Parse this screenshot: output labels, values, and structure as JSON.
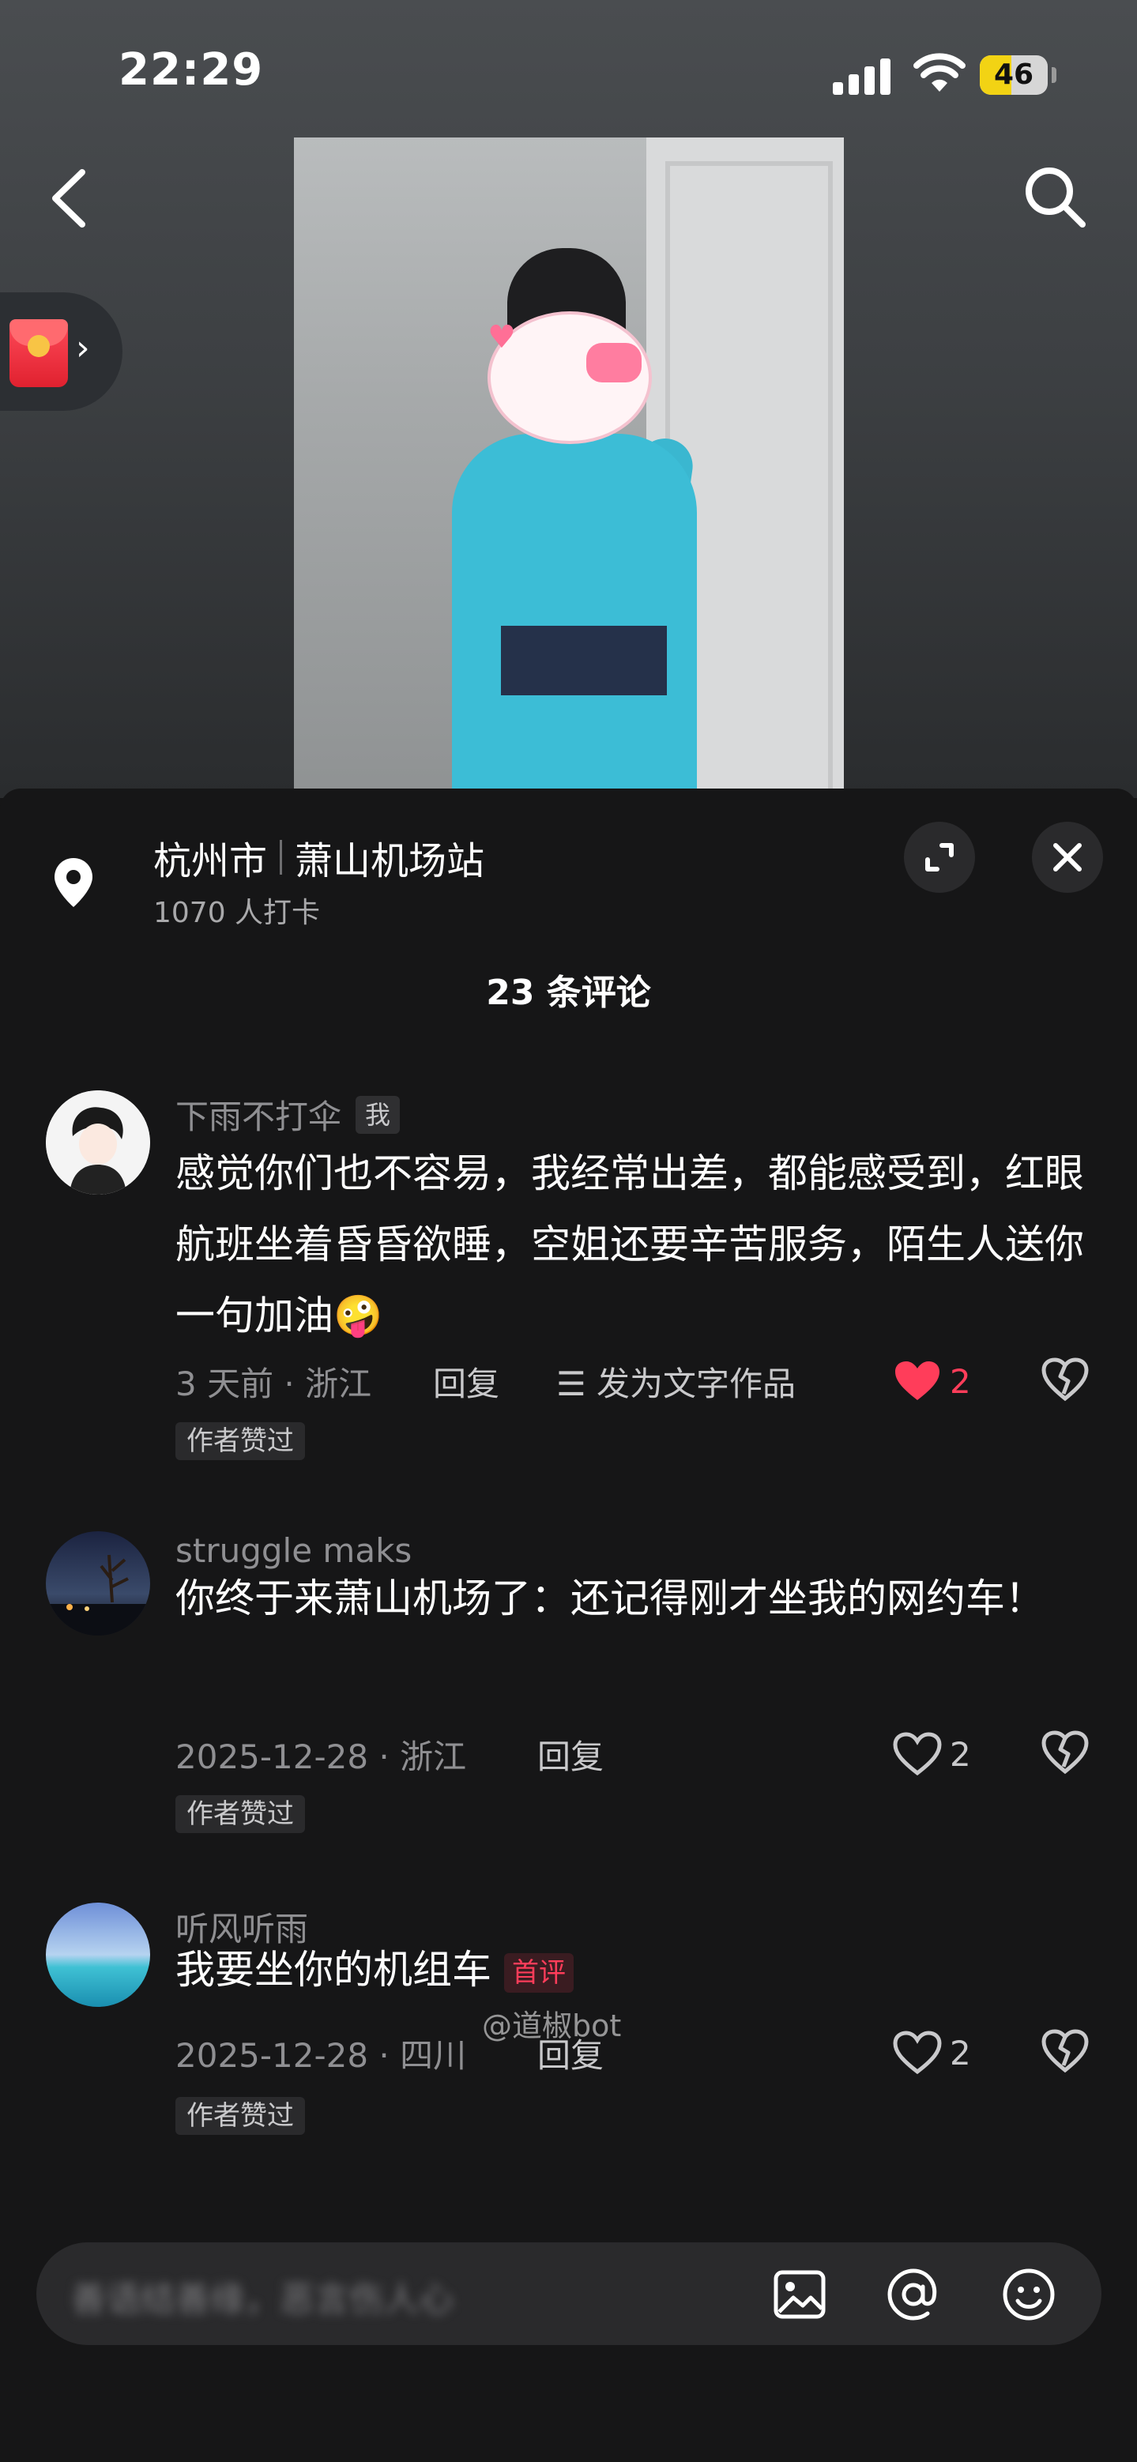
{
  "status_bar": {
    "time": "22:29",
    "battery": "46"
  },
  "location": {
    "city": "杭州市",
    "place": "萧山机场站",
    "checkins": "1070 人打卡"
  },
  "comments_header": {
    "count_label": "23 条评论"
  },
  "comments": [
    {
      "username": "下雨不打伞",
      "me_tag": "我",
      "text": "感觉你们也不容易，我经常出差，都能感受到，红眼航班坐着昏昏欲睡，空姐还要辛苦服务，陌生人送你一句加油🤪",
      "meta": "3 天前 · 浙江",
      "reply": "回复",
      "post_as_text": "☰ 发为文字作品",
      "likes": "2",
      "liked": true,
      "author_tag": "作者赞过"
    },
    {
      "username": "struggle maks",
      "text": "你终于来萧山机场了：还记得刚才坐我的网约车！",
      "meta": "2025-12-28 · 浙江",
      "reply": "回复",
      "likes": "2",
      "liked": false,
      "author_tag": "作者赞过"
    },
    {
      "username": "听风听雨",
      "text": "我要坐你的机组车",
      "first_tag": "首评",
      "meta": "2025-12-28 · 四川",
      "reply": "回复",
      "likes": "2",
      "liked": false,
      "author_tag": "作者赞过"
    }
  ],
  "watermark": "@道椒bot",
  "input": {
    "placeholder": "善语结善缘，恶言伤人心"
  },
  "icons": {
    "back": "chevron-left-icon",
    "search": "search-icon",
    "red_packet": "red-packet-icon",
    "location": "location-pin-icon",
    "expand": "expand-icon",
    "close": "close-icon",
    "like": "heart-icon",
    "dislike": "broken-heart-icon",
    "image": "image-icon",
    "mention": "at-icon",
    "emoji": "emoji-icon"
  },
  "colors": {
    "accent_red": "#ff3d5a",
    "battery_yellow": "#f2d314",
    "sheet_bg": "#161617"
  }
}
